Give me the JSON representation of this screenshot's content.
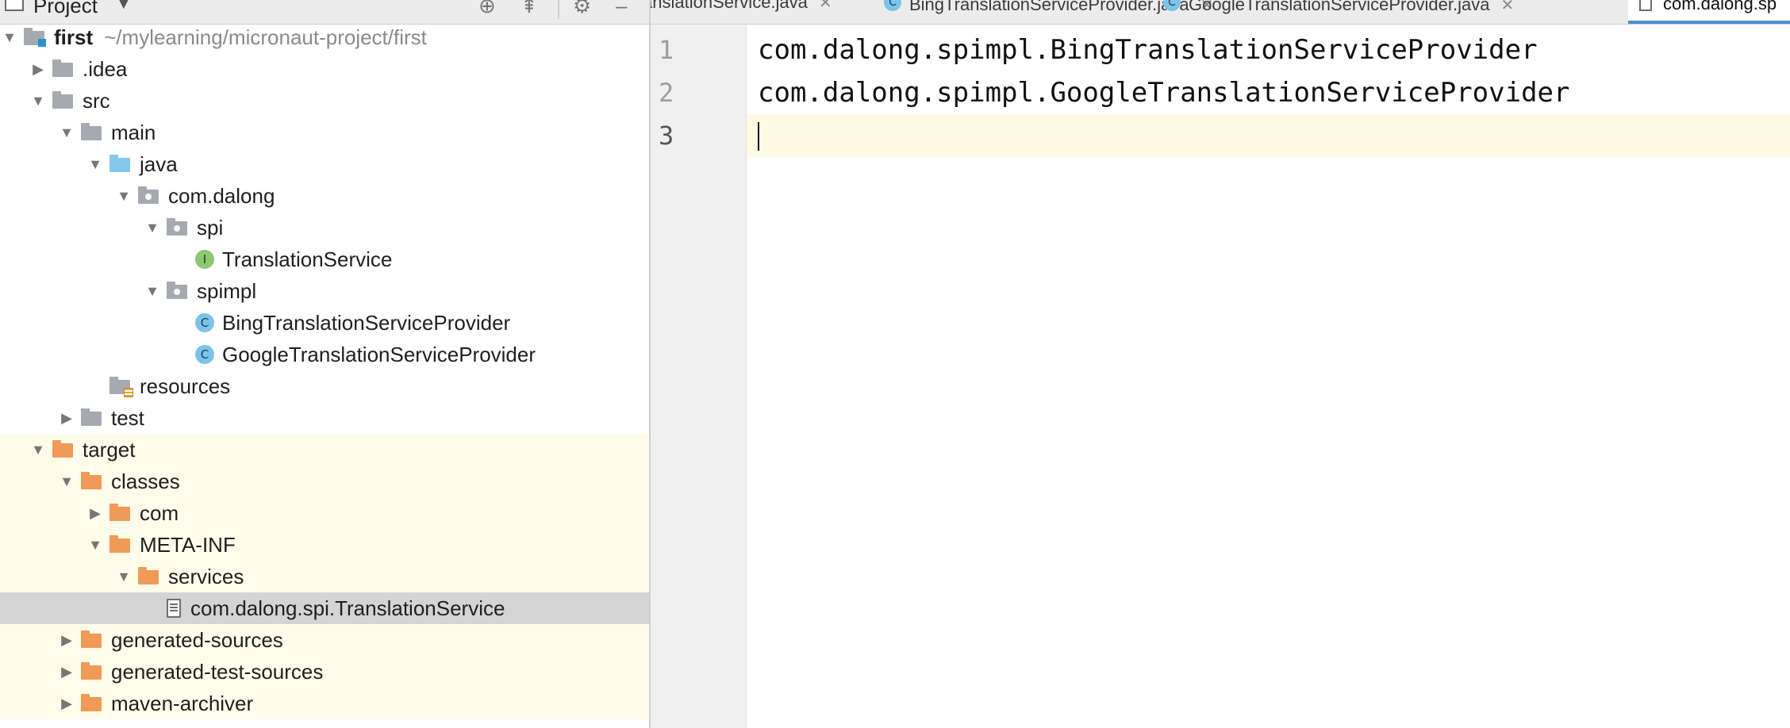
{
  "project_panel": {
    "title": "Project",
    "tree": [
      {
        "id": "first",
        "label": "first",
        "hint": "~/mylearning/micronaut-project/first",
        "arrow": "down",
        "icon": "module-folder-icon",
        "depth": 0
      },
      {
        "id": "idea",
        "label": ".idea",
        "arrow": "right",
        "icon": "folder-gray",
        "depth": 1
      },
      {
        "id": "src",
        "label": "src",
        "arrow": "down",
        "icon": "folder-gray",
        "depth": 1
      },
      {
        "id": "main",
        "label": "main",
        "arrow": "down",
        "icon": "folder-gray",
        "depth": 2
      },
      {
        "id": "java",
        "label": "java",
        "arrow": "down",
        "icon": "folder-blue",
        "depth": 3
      },
      {
        "id": "com-dalong",
        "label": "com.dalong",
        "arrow": "down",
        "icon": "package",
        "depth": 4
      },
      {
        "id": "spi",
        "label": "spi",
        "arrow": "down",
        "icon": "package",
        "depth": 5
      },
      {
        "id": "translation-service",
        "label": "TranslationService",
        "arrow": "none",
        "icon": "interface",
        "depth": 6
      },
      {
        "id": "spimpl",
        "label": "spimpl",
        "arrow": "down",
        "icon": "package",
        "depth": 5
      },
      {
        "id": "bing-provider",
        "label": "BingTranslationServiceProvider",
        "arrow": "none",
        "icon": "class",
        "depth": 6
      },
      {
        "id": "google-provider",
        "label": "GoogleTranslationServiceProvider",
        "arrow": "none",
        "icon": "class",
        "depth": 6
      },
      {
        "id": "resources",
        "label": "resources",
        "arrow": "none",
        "icon": "resources-folder",
        "depth": 3
      },
      {
        "id": "test",
        "label": "test",
        "arrow": "right",
        "icon": "folder-gray",
        "depth": 2
      },
      {
        "id": "target",
        "label": "target",
        "arrow": "down",
        "icon": "folder-orange",
        "depth": 1,
        "excluded": true
      },
      {
        "id": "classes",
        "label": "classes",
        "arrow": "down",
        "icon": "folder-orange",
        "depth": 2,
        "excluded": true
      },
      {
        "id": "com",
        "label": "com",
        "arrow": "right",
        "icon": "folder-orange",
        "depth": 3,
        "excluded": true
      },
      {
        "id": "meta-inf",
        "label": "META-INF",
        "arrow": "down",
        "icon": "folder-orange",
        "depth": 3,
        "excluded": true
      },
      {
        "id": "services",
        "label": "services",
        "arrow": "down",
        "icon": "folder-orange",
        "depth": 4,
        "excluded": true
      },
      {
        "id": "spi-file",
        "label": "com.dalong.spi.TranslationService",
        "arrow": "none",
        "icon": "text-file",
        "depth": 5,
        "excluded": true,
        "selected": true
      },
      {
        "id": "generated-sources",
        "label": "generated-sources",
        "arrow": "right",
        "icon": "folder-orange",
        "depth": 2,
        "excluded": true
      },
      {
        "id": "generated-test-sources",
        "label": "generated-test-sources",
        "arrow": "right",
        "icon": "folder-orange",
        "depth": 2,
        "excluded": true
      },
      {
        "id": "maven-archiver",
        "label": "maven-archiver",
        "arrow": "right",
        "icon": "folder-orange",
        "depth": 2,
        "excluded": true
      }
    ]
  },
  "tabs": [
    {
      "label": "anslationService.java",
      "icon": "none"
    },
    {
      "label": "BingTranslationServiceProvider.java",
      "icon": "class"
    },
    {
      "label": "GoogleTranslationServiceProvider.java",
      "icon": "class"
    },
    {
      "label": "com.dalong.sp",
      "icon": "text-file",
      "active": true
    }
  ],
  "editor": {
    "lines": [
      {
        "number": "1",
        "text": "com.dalong.spimpl.BingTranslationServiceProvider"
      },
      {
        "number": "2",
        "text": "com.dalong.spimpl.GoogleTranslationServiceProvider"
      },
      {
        "number": "3",
        "text": "",
        "current": true
      }
    ]
  },
  "colors": {
    "excluded_bg": "#fffdea",
    "selected_bg": "#d4d4d4",
    "current_line_bg": "#fffae3",
    "folder_orange": "#f09a58",
    "folder_blue": "#86c7ee",
    "folder_gray": "#a6aab0"
  }
}
